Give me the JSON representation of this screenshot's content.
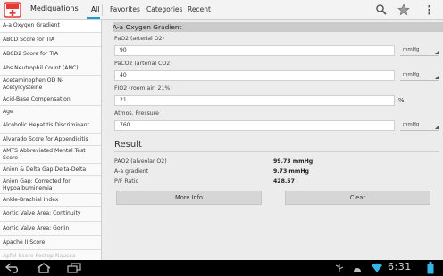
{
  "app": {
    "title": "Mediquations",
    "icon": "mediquations-app-icon",
    "brand_color": "#e53935"
  },
  "tabs": [
    {
      "label": "All",
      "active": true
    },
    {
      "label": "Favorites",
      "active": false
    },
    {
      "label": "Categories",
      "active": false
    },
    {
      "label": "Recent",
      "active": false
    }
  ],
  "accent_color": "#1b9bd8",
  "actions": {
    "search_icon": "search-icon",
    "favorite_icon": "star-icon",
    "menu_icon": "overflow-menu-icon"
  },
  "sidebar": {
    "items": [
      {
        "label": "A-a Oxygen Gradient"
      },
      {
        "label": "ABCD Score for TIA"
      },
      {
        "label": "ABCD2 Score for TIA"
      },
      {
        "label": "Abs Neutrophil Count (ANC)"
      },
      {
        "label": "Acetaminophen OD N-Acetylcysteine"
      },
      {
        "label": "Acid-Base Compensation"
      },
      {
        "label": "Age"
      },
      {
        "label": "Alcoholic Hepatitis Discriminant"
      },
      {
        "label": "Alvarado Score for Appendicitis"
      },
      {
        "label": "AMTS Abbreviated Mental Test Score"
      },
      {
        "label": "Anion & Delta Gap,Delta-Delta"
      },
      {
        "label": "Anion Gap: Corrected for Hypoalbuminemia"
      },
      {
        "label": "Ankle-Brachial Index"
      },
      {
        "label": "Aortic Valve Area: Continuity"
      },
      {
        "label": "Aortic Valve Area: Gorlin"
      },
      {
        "label": "Apache II Score"
      },
      {
        "label": "Apfel Score Postop Nausea"
      }
    ]
  },
  "calculator": {
    "title": "A-a Oxygen Gradient",
    "fields": [
      {
        "label": "PaO2 (arterial O2)",
        "value": "90",
        "unit": "mmHg",
        "unit_type": "dropdown"
      },
      {
        "label": "PaCO2 (arterial CO2)",
        "value": "40",
        "unit": "mmHg",
        "unit_type": "dropdown"
      },
      {
        "label": "FIO2 (room air: 21%)",
        "value": "21",
        "unit": "%",
        "unit_type": "text"
      },
      {
        "label": "Atmos. Pressure",
        "value": "760",
        "unit": "mmHg",
        "unit_type": "dropdown"
      }
    ]
  },
  "result": {
    "title": "Result",
    "rows": [
      {
        "label": "PAO2 (alveolar O2)",
        "value": "99.73 mmHg"
      },
      {
        "label": "A-a gradient",
        "value": "9.73 mmHg"
      },
      {
        "label": "P/F Ratio",
        "value": "428.57"
      }
    ]
  },
  "buttons": {
    "more_info": "More Info",
    "clear": "Clear"
  },
  "system_bar": {
    "time": "6:31",
    "icons": [
      "back-icon",
      "home-icon",
      "recent-apps-icon",
      "usb-icon",
      "android-debug-icon",
      "wifi-icon",
      "battery-icon"
    ]
  }
}
